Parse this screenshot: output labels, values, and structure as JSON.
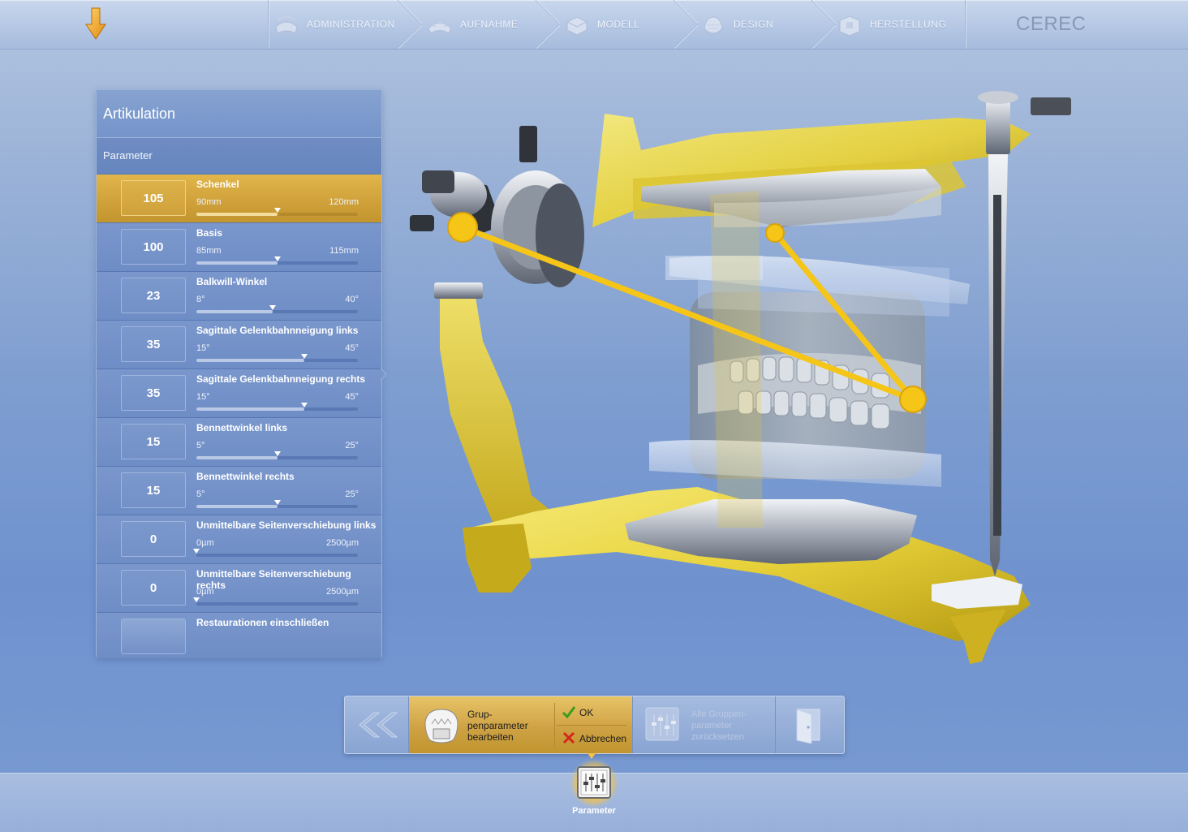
{
  "topbar": {
    "brand": "CEREC",
    "steps": [
      {
        "label": "ADMINISTRATION",
        "icon": "administration-icon"
      },
      {
        "label": "AUFNAHME",
        "icon": "scan-icon"
      },
      {
        "label": "MODELL",
        "icon": "model-icon"
      },
      {
        "label": "DESIGN",
        "icon": "design-icon"
      },
      {
        "label": "HERSTELLUNG",
        "icon": "milling-icon"
      }
    ]
  },
  "panel": {
    "title": "Artikulation",
    "section": "Parameter",
    "params": [
      {
        "label": "Schenkel",
        "value": "105",
        "min": "90mm",
        "max": "120mm",
        "level": 0.5,
        "active": true
      },
      {
        "label": "Basis",
        "value": "100",
        "min": "85mm",
        "max": "115mm",
        "level": 0.5
      },
      {
        "label": "Balkwill-Winkel",
        "value": "23",
        "min": "8°",
        "max": "40°",
        "level": 0.47
      },
      {
        "label": "Sagittale Gelenkbahnneigung links",
        "value": "35",
        "min": "15°",
        "max": "45°",
        "level": 0.67
      },
      {
        "label": "Sagittale Gelenkbahnneigung rechts",
        "value": "35",
        "min": "15°",
        "max": "45°",
        "level": 0.67
      },
      {
        "label": "Bennettwinkel links",
        "value": "15",
        "min": "5°",
        "max": "25°",
        "level": 0.5
      },
      {
        "label": "Bennettwinkel rechts",
        "value": "15",
        "min": "5°",
        "max": "25°",
        "level": 0.5
      },
      {
        "label": "Unmittelbare Seitenverschiebung links",
        "value": "0",
        "min": "0µm",
        "max": "2500µm",
        "level": 0.0
      },
      {
        "label": "Unmittelbare Seitenverschiebung rechts",
        "value": "0",
        "min": "0µm",
        "max": "2500µm",
        "level": 0.0
      }
    ],
    "toggle_label": "Restaurationen einschließen"
  },
  "toolbar": {
    "group_label": "Grup-\npenparameter\nbearbeiten",
    "ok_label": "OK",
    "cancel_label": "Abbrechen",
    "reset_label": "Alle Gruppen-\nparameter\nzurücksetzen"
  },
  "bottom": {
    "param_label": "Parameter"
  },
  "colors": {
    "accent": "#D4A83E",
    "articulator_yellow": "#F2D62A",
    "highlight_line": "#F5C518"
  }
}
